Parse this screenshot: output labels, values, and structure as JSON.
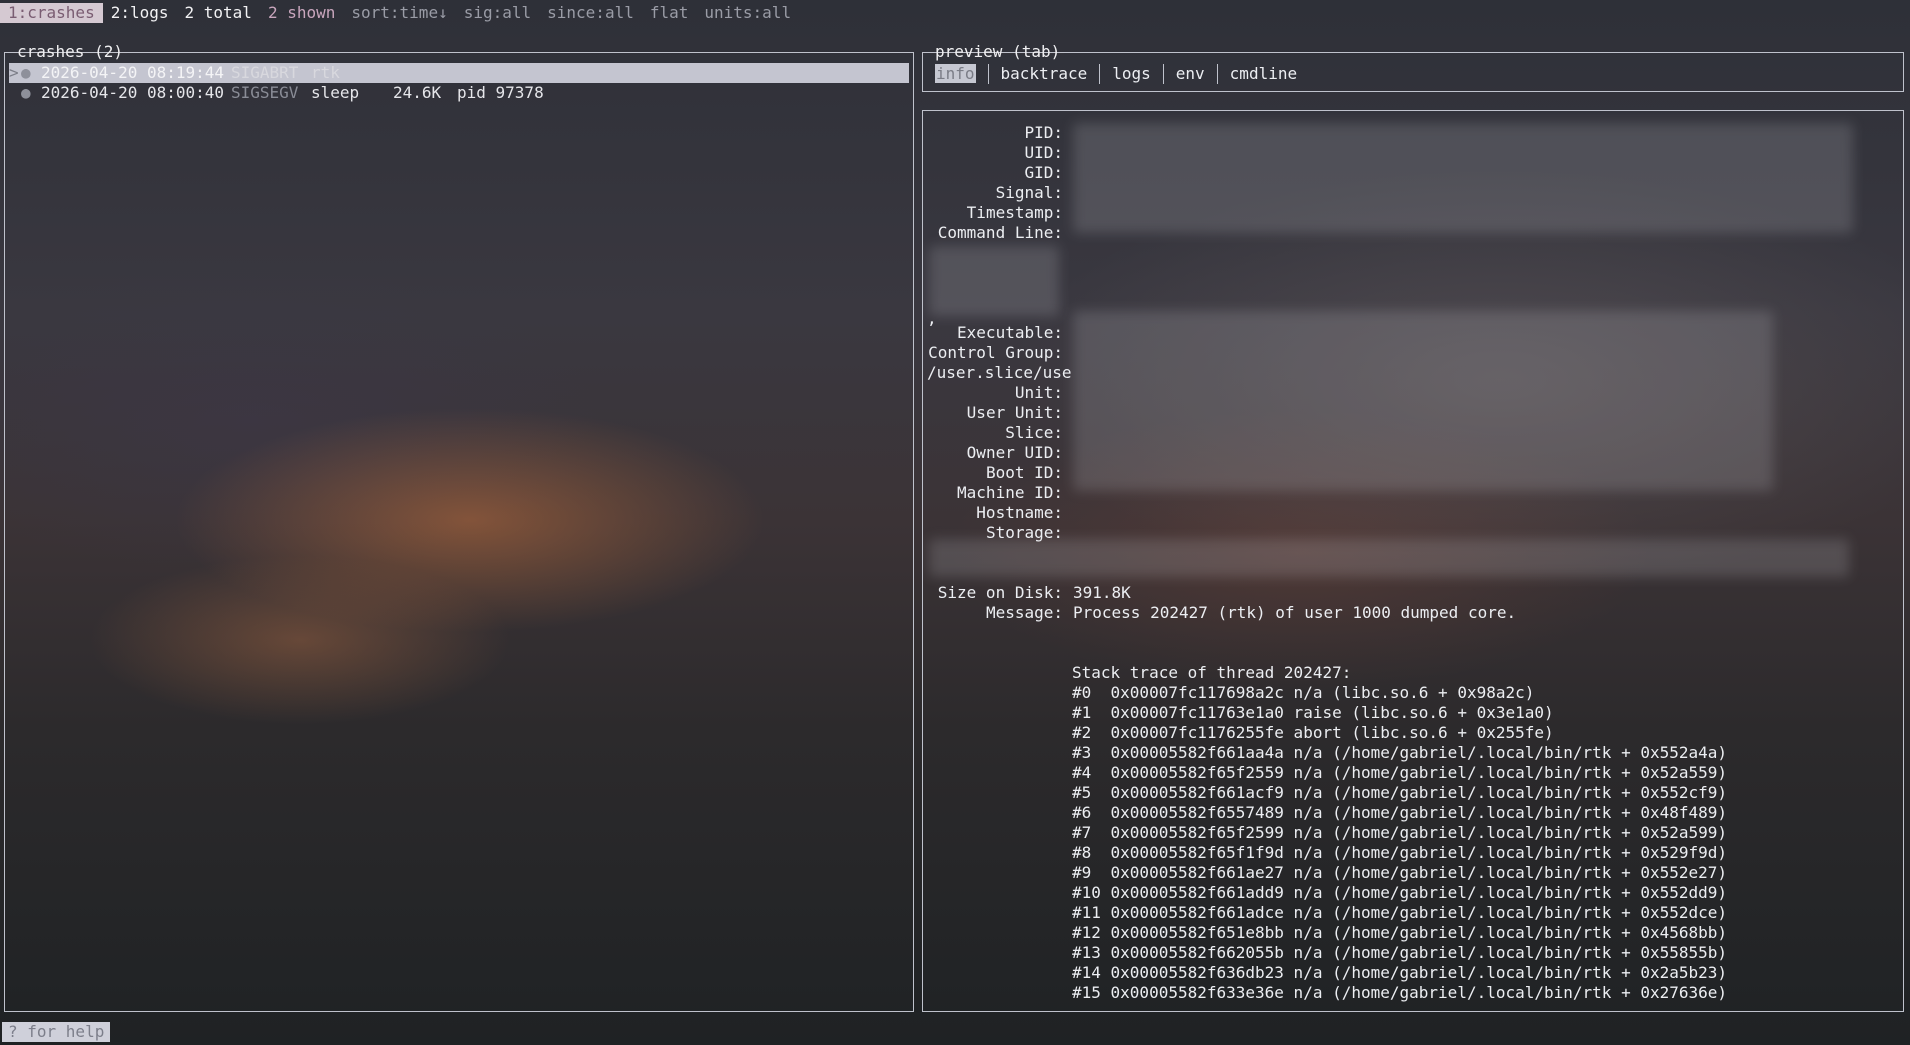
{
  "topbar": {
    "tab_crashes": "1:crashes",
    "tab_logs": "2:logs",
    "total": "2 total",
    "shown": "2 shown",
    "sort": "sort:time↓",
    "sig": "sig:all",
    "since": "since:all",
    "flat": "flat",
    "units": "units:all"
  },
  "crashes": {
    "title": "crashes (2)",
    "rows": [
      {
        "cursor": ">",
        "dot": "●",
        "timestamp": "2026-04-20 08:19:44",
        "signal": "SIGABRT",
        "program": "rtk",
        "size": "",
        "pid": ""
      },
      {
        "cursor": "",
        "dot": "●",
        "timestamp": "2026-04-20 08:00:40",
        "signal": "SIGSEGV",
        "program": "sleep",
        "size": "24.6K",
        "pid": "pid 97378"
      }
    ]
  },
  "preview": {
    "title": "preview (tab)",
    "tabs": [
      "info",
      "backtrace",
      "logs",
      "env",
      "cmdline"
    ]
  },
  "details": {
    "labels": {
      "pid": "PID:",
      "uid": "UID:",
      "gid": "GID:",
      "signal": "Signal:",
      "timestamp": "Timestamp:",
      "command_line": "Command Line:",
      "executable": "Executable:",
      "control_group": "Control Group:",
      "cgroup_cont": "/user.slice/use",
      "unit": "Unit:",
      "user_unit": "User Unit:",
      "slice": "Slice:",
      "owner_uid": "Owner UID:",
      "boot_id": "Boot ID:",
      "machine_id": "Machine ID:",
      "hostname": "Hostname:",
      "storage": "Storage:",
      "size_on_disk": "Size on Disk:",
      "message": "Message:"
    },
    "size_on_disk": "391.8K",
    "message": "Process 202427 (rtk) of user 1000 dumped core.",
    "cont_mark": ",",
    "trace_header": "Stack trace of thread 202427:",
    "trace": [
      "#0  0x00007fc117698a2c n/a (libc.so.6 + 0x98a2c)",
      "#1  0x00007fc11763e1a0 raise (libc.so.6 + 0x3e1a0)",
      "#2  0x00007fc1176255fe abort (libc.so.6 + 0x255fe)",
      "#3  0x00005582f661aa4a n/a (/home/gabriel/.local/bin/rtk + 0x552a4a)",
      "#4  0x00005582f65f2559 n/a (/home/gabriel/.local/bin/rtk + 0x52a559)",
      "#5  0x00005582f661acf9 n/a (/home/gabriel/.local/bin/rtk + 0x552cf9)",
      "#6  0x00005582f6557489 n/a (/home/gabriel/.local/bin/rtk + 0x48f489)",
      "#7  0x00005582f65f2599 n/a (/home/gabriel/.local/bin/rtk + 0x52a599)",
      "#8  0x00005582f65f1f9d n/a (/home/gabriel/.local/bin/rtk + 0x529f9d)",
      "#9  0x00005582f661ae27 n/a (/home/gabriel/.local/bin/rtk + 0x552e27)",
      "#10 0x00005582f661add9 n/a (/home/gabriel/.local/bin/rtk + 0x552dd9)",
      "#11 0x00005582f661adce n/a (/home/gabriel/.local/bin/rtk + 0x552dce)",
      "#12 0x00005582f651e8bb n/a (/home/gabriel/.local/bin/rtk + 0x4568bb)",
      "#13 0x00005582f662055b n/a (/home/gabriel/.local/bin/rtk + 0x55855b)",
      "#14 0x00005582f636db23 n/a (/home/gabriel/.local/bin/rtk + 0x2a5b23)",
      "#15 0x00005582f633e36e n/a (/home/gabriel/.local/bin/rtk + 0x27636e)"
    ]
  },
  "footer": {
    "help": "? for help"
  }
}
